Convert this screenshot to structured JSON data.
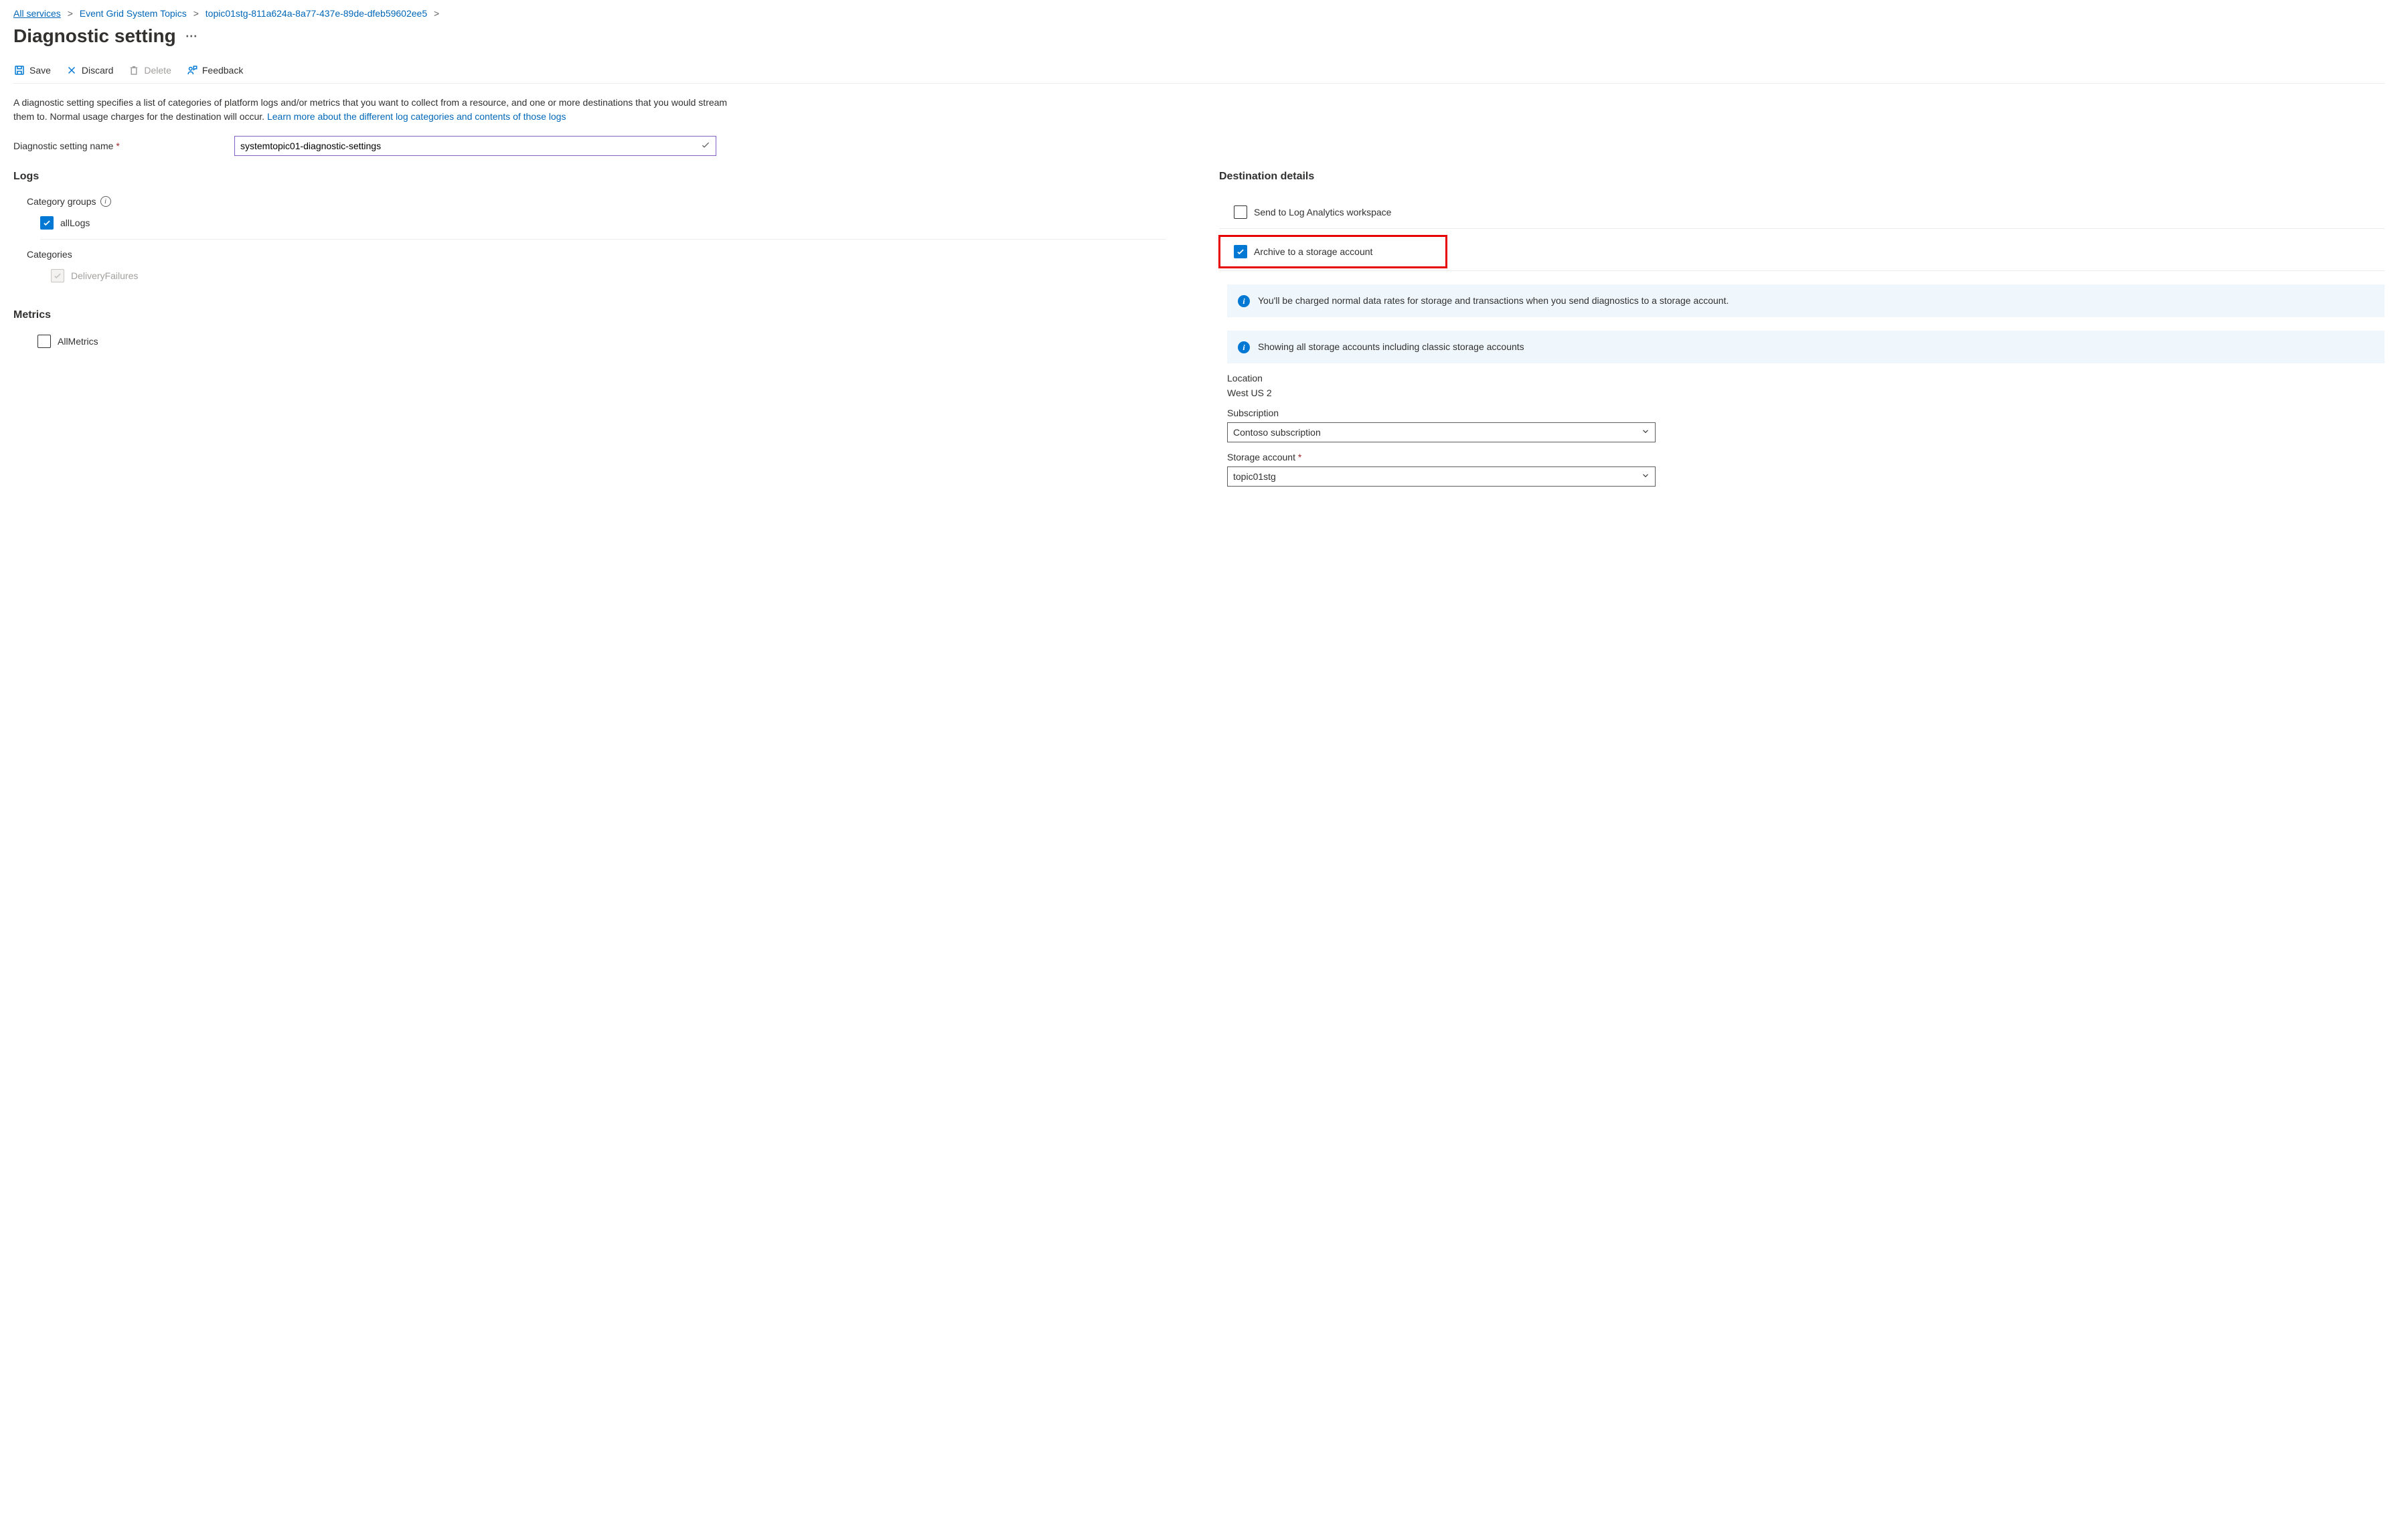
{
  "breadcrumb": {
    "items": [
      "All services",
      "Event Grid System Topics",
      "topic01stg-811a624a-8a77-437e-89de-dfeb59602ee5"
    ]
  },
  "page": {
    "title": "Diagnostic setting"
  },
  "toolbar": {
    "save": "Save",
    "discard": "Discard",
    "delete": "Delete",
    "feedback": "Feedback"
  },
  "description": {
    "text": "A diagnostic setting specifies a list of categories of platform logs and/or metrics that you want to collect from a resource, and one or more destinations that you would stream them to. Normal usage charges for the destination will occur. ",
    "link": "Learn more about the different log categories and contents of those logs"
  },
  "nameField": {
    "label": "Diagnostic setting name",
    "value": "systemtopic01-diagnostic-settings"
  },
  "logs": {
    "heading": "Logs",
    "categoryGroupsLabel": "Category groups",
    "allLogs": {
      "label": "allLogs",
      "checked": true
    },
    "categoriesLabel": "Categories",
    "deliveryFailures": {
      "label": "DeliveryFailures",
      "checked": false
    }
  },
  "metrics": {
    "heading": "Metrics",
    "allMetrics": {
      "label": "AllMetrics",
      "checked": false
    }
  },
  "dest": {
    "heading": "Destination details",
    "logAnalytics": {
      "label": "Send to Log Analytics workspace",
      "checked": false
    },
    "archive": {
      "label": "Archive to a storage account",
      "checked": true
    },
    "info1": "You'll be charged normal data rates for storage and transactions when you send diagnostics to a storage account.",
    "info2": "Showing all storage accounts including classic storage accounts",
    "locationLabel": "Location",
    "locationValue": "West US 2",
    "subscriptionLabel": "Subscription",
    "subscriptionValue": "Contoso subscription",
    "storageLabel": "Storage account",
    "storageValue": "topic01stg"
  }
}
